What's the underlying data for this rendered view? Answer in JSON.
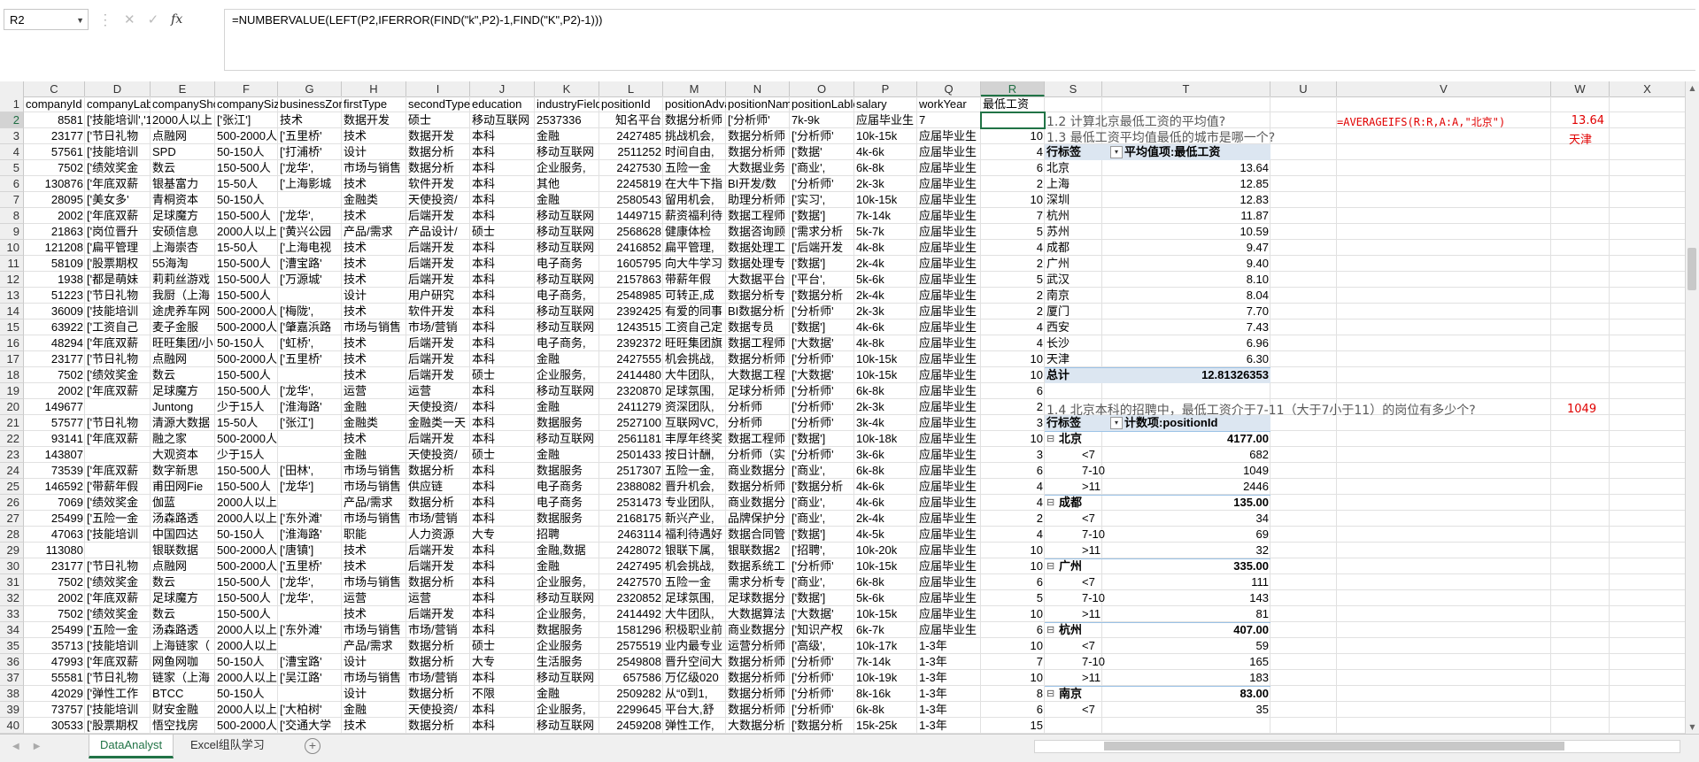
{
  "namebox": "R2",
  "formula": "=NUMBERVALUE(LEFT(P2,IFERROR(FIND(\"k\",P2)-1,FIND(\"K\",P2)-1)))",
  "columns": [
    "C",
    "D",
    "E",
    "F",
    "G",
    "H",
    "I",
    "J",
    "K",
    "L",
    "M",
    "N",
    "O",
    "P",
    "Q",
    "R",
    "S",
    "T",
    "U",
    "V",
    "W",
    "X"
  ],
  "row_numbers": [
    "1",
    "2",
    "3",
    "4",
    "5",
    "6",
    "7",
    "8",
    "9",
    "10",
    "11",
    "12",
    "13",
    "14",
    "15",
    "16",
    "17",
    "18",
    "19",
    "20",
    "21",
    "22",
    "23",
    "24",
    "25",
    "26",
    "27",
    "28",
    "29",
    "30",
    "31",
    "32",
    "33",
    "34",
    "35",
    "36",
    "37",
    "38",
    "39",
    "40"
  ],
  "headers": [
    "companyId",
    "companyLabelList",
    "companyShortName",
    "companySize",
    "businessZones",
    "firstType",
    "secondType",
    "education",
    "industryField",
    "positionId",
    "positionAdvantage",
    "positionName",
    "positionLables",
    "salary",
    "workYear",
    "最低工资"
  ],
  "rows": [
    [
      "8581",
      "['技能培训','1号店",
      "2000人以上",
      "['张江']",
      "技术",
      "数据开发",
      "硕士",
      "移动互联网",
      "2537336",
      "知名平台",
      "数据分析师",
      "['分析师'",
      "7k-9k",
      "应届毕业生",
      "7"
    ],
    [
      "23177",
      "['节日礼物",
      "点融网",
      "500-2000人",
      "['五里桥'",
      "技术",
      "数据开发",
      "本科",
      "金融",
      "2427485",
      "挑战机会,",
      "数据分析师",
      "['分析师'",
      "10k-15k",
      "应届毕业生",
      "10"
    ],
    [
      "57561",
      "['技能培训",
      "SPD",
      "50-150人",
      "['打浦桥'",
      "设计",
      "数据分析",
      "本科",
      "移动互联网",
      "2511252",
      "时间自由,",
      "数据分析师",
      "['数据'",
      "4k-6k",
      "应届毕业生",
      "4"
    ],
    [
      "7502",
      "['绩效奖金",
      "数云",
      "150-500人",
      "['龙华',",
      "市场与销售",
      "数据分析",
      "本科",
      "企业服务,",
      "2427530",
      "五险一金",
      "大数据业务",
      "['商业',",
      "6k-8k",
      "应届毕业生",
      "6"
    ],
    [
      "130876",
      "['年底双薪",
      "银基富力",
      "15-50人",
      "['上海影城",
      "技术",
      "软件开发",
      "本科",
      "其他",
      "2245819",
      "在大牛下指",
      "BI开发/数",
      "['分析师'",
      "2k-3k",
      "应届毕业生",
      "2"
    ],
    [
      "28095",
      "['美女多'",
      "青桐资本",
      "50-150人",
      "",
      "金融类",
      "天使投资/",
      "本科",
      "金融",
      "2580543",
      "留用机会,",
      "助理分析师",
      "['实习',",
      "10k-15k",
      "应届毕业生",
      "10"
    ],
    [
      "2002",
      "['年底双薪",
      "足球魔方",
      "150-500人",
      "['龙华',",
      "技术",
      "后端开发",
      "本科",
      "移动互联网",
      "1449715",
      "薪资福利待",
      "数据工程师",
      "['数据']",
      "7k-14k",
      "应届毕业生",
      "7"
    ],
    [
      "21863",
      "['岗位晋升",
      "安硕信息",
      "2000人以上",
      "['黄兴公园",
      "产品/需求",
      "产品设计/",
      "硕士",
      "移动互联网",
      "2568628",
      "健康体检",
      "数据咨询顾",
      "['需求分析",
      "5k-7k",
      "应届毕业生",
      "5"
    ],
    [
      "121208",
      "['扁平管理",
      "上海崇杏",
      "15-50人",
      "['上海电视",
      "技术",
      "后端开发",
      "本科",
      "移动互联网",
      "2416852",
      "扁平管理,",
      "数据处理工",
      "['后端开发",
      "4k-8k",
      "应届毕业生",
      "4"
    ],
    [
      "58109",
      "['股票期权",
      "55海淘",
      "150-500人",
      "['漕宝路'",
      "技术",
      "后端开发",
      "本科",
      "电子商务",
      "1605795",
      "向大牛学习",
      "数据处理专",
      "['数据']",
      "2k-4k",
      "应届毕业生",
      "2"
    ],
    [
      "1938",
      "['都是萌妹",
      "莉莉丝游戏",
      "150-500人",
      "['万源城'",
      "技术",
      "后端开发",
      "本科",
      "移动互联网",
      "2157863",
      "带薪年假",
      "大数据平台",
      "['平台',",
      "5k-6k",
      "应届毕业生",
      "5"
    ],
    [
      "51223",
      "['节日礼物",
      "我厨（上海",
      "150-500人",
      "",
      "设计",
      "用户研究",
      "本科",
      "电子商务,",
      "2548985",
      "可转正,成",
      "数据分析专",
      "['数据分析",
      "2k-4k",
      "应届毕业生",
      "2"
    ],
    [
      "36009",
      "['技能培训",
      "途虎养车网",
      "500-2000人",
      "['梅陇',",
      "技术",
      "软件开发",
      "本科",
      "移动互联网",
      "2392425",
      "有爱的同事",
      "BI数据分析",
      "['分析师'",
      "2k-3k",
      "应届毕业生",
      "2"
    ],
    [
      "63922",
      "['工资自己",
      "麦子金服",
      "500-2000人",
      "['肇嘉浜路",
      "市场与销售",
      "市场/营销",
      "本科",
      "移动互联网",
      "1243515",
      "工资自己定",
      "数据专员",
      "['数据']",
      "4k-6k",
      "应届毕业生",
      "4"
    ],
    [
      "48294",
      "['年底双薪",
      "旺旺集团/小",
      "50-150人",
      "['虹桥',",
      "技术",
      "后端开发",
      "本科",
      "电子商务,",
      "2392372",
      "旺旺集团旗",
      "数据工程师",
      "['大数据'",
      "4k-8k",
      "应届毕业生",
      "4"
    ],
    [
      "23177",
      "['节日礼物",
      "点融网",
      "500-2000人",
      "['五里桥'",
      "技术",
      "后端开发",
      "本科",
      "金融",
      "2427555",
      "机会挑战,",
      "数据分析师",
      "['分析师'",
      "10k-15k",
      "应届毕业生",
      "10"
    ],
    [
      "7502",
      "['绩效奖金",
      "数云",
      "150-500人",
      "",
      "技术",
      "后端开发",
      "硕士",
      "企业服务,",
      "2414480",
      "大牛团队,",
      "大数据工程",
      "['大数据'",
      "10k-15k",
      "应届毕业生",
      "10"
    ],
    [
      "2002",
      "['年底双薪",
      "足球魔方",
      "150-500人",
      "['龙华',",
      "运营",
      "运营",
      "本科",
      "移动互联网",
      "2320870",
      "足球氛围,",
      "足球分析师",
      "['分析师'",
      "6k-8k",
      "应届毕业生",
      "6"
    ],
    [
      "149677",
      "",
      "Juntong",
      "少于15人",
      "['淮海路'",
      "金融",
      "天使投资/",
      "本科",
      "金融",
      "2411279",
      "资深团队,",
      "分析师",
      "['分析师'",
      "2k-3k",
      "应届毕业生",
      "2"
    ],
    [
      "57577",
      "['节日礼物",
      "清源大数据",
      "15-50人",
      "['张江']",
      "金融类",
      "金融类一天",
      "本科",
      "数据服务",
      "2527100",
      "互联网VC,",
      "分析师",
      "['分析师'",
      "3k-4k",
      "应届毕业生",
      "3"
    ],
    [
      "93141",
      "['年底双薪",
      "融之家",
      "500-2000人",
      "",
      "技术",
      "后端开发",
      "本科",
      "移动互联网",
      "2561181",
      "丰厚年终奖",
      "数据工程师",
      "['数据']",
      "10k-18k",
      "应届毕业生",
      "10"
    ],
    [
      "143807",
      "",
      "大观资本",
      "少于15人",
      "",
      "金融",
      "天使投资/",
      "硕士",
      "金融",
      "2501433",
      "按日计酬,",
      "分析师（实",
      "['分析师'",
      "3k-6k",
      "应届毕业生",
      "3"
    ],
    [
      "73539",
      "['年底双薪",
      "数字新思",
      "150-500人",
      "['田林',",
      "市场与销售",
      "数据分析",
      "本科",
      "数据服务",
      "2517307",
      "五险一金,",
      "商业数据分",
      "['商业',",
      "6k-8k",
      "应届毕业生",
      "6"
    ],
    [
      "146592",
      "['带薪年假",
      "甫田网Fie",
      "150-500人",
      "['龙华']",
      "市场与销售",
      "供应链",
      "本科",
      "电子商务",
      "2388082",
      "晋升机会,",
      "数据分析师",
      "['数据分析",
      "4k-6k",
      "应届毕业生",
      "4"
    ],
    [
      "7069",
      "['绩效奖金",
      "伽蓝",
      "2000人以上",
      "",
      "产品/需求",
      "数据分析",
      "本科",
      "电子商务",
      "2531473",
      "专业团队,",
      "商业数据分",
      "['商业',",
      "4k-6k",
      "应届毕业生",
      "4"
    ],
    [
      "25499",
      "['五险一金",
      "汤森路透",
      "2000人以上",
      "['东外滩'",
      "市场与销售",
      "市场/营销",
      "本科",
      "数据服务",
      "2168175",
      "新兴产业,",
      "品牌保护分",
      "['商业',",
      "2k-4k",
      "应届毕业生",
      "2"
    ],
    [
      "47063",
      "['技能培训",
      "中国四达",
      "50-150人",
      "['淮海路'",
      "职能",
      "人力资源",
      "大专",
      "招聘",
      "2463114",
      "福利待遇好",
      "数据合同管",
      "['数据']",
      "4k-5k",
      "应届毕业生",
      "4"
    ],
    [
      "113080",
      "",
      "银联数据",
      "500-2000人",
      "['唐镇']",
      "技术",
      "后端开发",
      "本科",
      "金融,数据",
      "2428072",
      "银联下属,",
      "银联数据2",
      "['招聘',",
      "10k-20k",
      "应届毕业生",
      "10"
    ],
    [
      "23177",
      "['节日礼物",
      "点融网",
      "500-2000人",
      "['五里桥'",
      "技术",
      "后端开发",
      "本科",
      "金融",
      "2427495",
      "机会挑战,",
      "数据系统工",
      "['分析师'",
      "10k-15k",
      "应届毕业生",
      "10"
    ],
    [
      "7502",
      "['绩效奖金",
      "数云",
      "150-500人",
      "['龙华',",
      "市场与销售",
      "数据分析",
      "本科",
      "企业服务,",
      "2427570",
      "五险一金",
      "需求分析专",
      "['商业',",
      "6k-8k",
      "应届毕业生",
      "6"
    ],
    [
      "2002",
      "['年底双薪",
      "足球魔方",
      "150-500人",
      "['龙华',",
      "运营",
      "运营",
      "本科",
      "移动互联网",
      "2320852",
      "足球氛围,",
      "足球数据分",
      "['数据']",
      "5k-6k",
      "应届毕业生",
      "5"
    ],
    [
      "7502",
      "['绩效奖金",
      "数云",
      "150-500人",
      "",
      "技术",
      "后端开发",
      "本科",
      "企业服务,",
      "2414492",
      "大牛团队,",
      "大数据算法",
      "['大数据'",
      "10k-15k",
      "应届毕业生",
      "10"
    ],
    [
      "25499",
      "['五险一金",
      "汤森路透",
      "2000人以上",
      "['东外滩'",
      "市场与销售",
      "市场/营销",
      "本科",
      "数据服务",
      "1581296",
      "积极职业前",
      "商业数据分",
      "['知识产权",
      "6k-7k",
      "应届毕业生",
      "6"
    ],
    [
      "35713",
      "['技能培训",
      "上海链家（",
      "2000人以上",
      "",
      "产品/需求",
      "数据分析",
      "硕士",
      "企业服务",
      "2575519",
      "业内最专业",
      "运营分析师",
      "['高级',",
      "10k-17k",
      "1-3年",
      "10"
    ],
    [
      "47993",
      "['年底双薪",
      "网鱼网咖",
      "50-150人",
      "['漕宝路'",
      "设计",
      "数据分析",
      "大专",
      "生活服务",
      "2549808",
      "晋升空间大",
      "数据分析师",
      "['分析师'",
      "7k-14k",
      "1-3年",
      "7"
    ],
    [
      "55581",
      "['节日礼物",
      "链家（上海",
      "2000人以上",
      "['吴江路'",
      "市场与销售",
      "市场/营销",
      "本科",
      "移动互联网",
      "657586",
      "万亿级020",
      "数据分析师",
      "['分析师'",
      "10k-19k",
      "1-3年",
      "10"
    ],
    [
      "42029",
      "['弹性工作",
      "BTCC",
      "50-150人",
      "",
      "设计",
      "数据分析",
      "不限",
      "金融",
      "2509282",
      "从“0到1,",
      "数据分析师",
      "['分析师'",
      "8k-16k",
      "1-3年",
      "8"
    ],
    [
      "73757",
      "['技能培训",
      "财安金融",
      "2000人以上",
      "['大柏树'",
      "金融",
      "天使投资/",
      "本科",
      "企业服务,",
      "2299645",
      "平台大,舒",
      "数据分析师",
      "['分析师'",
      "6k-8k",
      "1-3年",
      "6"
    ],
    [
      "30533",
      "['股票期权",
      "悟空找房",
      "500-2000人",
      "['交通大学",
      "技术",
      "数据分析",
      "本科",
      "移动互联网",
      "2459208",
      "弹性工作,",
      "大数据分析",
      "['数据分析",
      "15k-25k",
      "1-3年",
      "15"
    ]
  ],
  "q12": "1.2 计算北京最低工资的平均值?",
  "q12_formula": "=AVERAGEIFS(R:R,A:A,\"北京\")",
  "q12_answer": "13.64",
  "q13": "1.3 最低工资平均值最低的城市是哪一个?",
  "q13_answer": "天津",
  "pivot1": {
    "hdr_label": "行标签",
    "hdr_value": "平均值项:最低工资",
    "rows": [
      {
        "city": "北京",
        "val": "13.64"
      },
      {
        "city": "上海",
        "val": "12.85"
      },
      {
        "city": "深圳",
        "val": "12.83"
      },
      {
        "city": "杭州",
        "val": "11.87"
      },
      {
        "city": "苏州",
        "val": "10.59"
      },
      {
        "city": "成都",
        "val": "9.47"
      },
      {
        "city": "广州",
        "val": "9.40"
      },
      {
        "city": "武汉",
        "val": "8.10"
      },
      {
        "city": "南京",
        "val": "8.04"
      },
      {
        "city": "厦门",
        "val": "7.70"
      },
      {
        "city": "西安",
        "val": "7.43"
      },
      {
        "city": "长沙",
        "val": "6.96"
      },
      {
        "city": "天津",
        "val": "6.30"
      }
    ],
    "total_label": "总计",
    "total_val": "12.81326353"
  },
  "q14": "1.4 北京本科的招聘中，最低工资介于7-11（大于7小于11）的岗位有多少个?",
  "q14_answer": "1049",
  "pivot2": {
    "hdr_label": "行标签",
    "hdr_value": "计数项:positionId",
    "groups": [
      {
        "city": "北京",
        "total": "4177.00",
        "items": [
          {
            "k": "<7",
            "v": "682"
          },
          {
            "k": "7-10",
            "v": "1049"
          },
          {
            "k": ">11",
            "v": "2446"
          }
        ]
      },
      {
        "city": "成都",
        "total": "135.00",
        "items": [
          {
            "k": "<7",
            "v": "34"
          },
          {
            "k": "7-10",
            "v": "69"
          },
          {
            "k": ">11",
            "v": "32"
          }
        ]
      },
      {
        "city": "广州",
        "total": "335.00",
        "items": [
          {
            "k": "<7",
            "v": "111"
          },
          {
            "k": "7-10",
            "v": "143"
          },
          {
            "k": ">11",
            "v": "81"
          }
        ]
      },
      {
        "city": "杭州",
        "total": "407.00",
        "items": [
          {
            "k": "<7",
            "v": "59"
          },
          {
            "k": "7-10",
            "v": "165"
          },
          {
            "k": ">11",
            "v": "183"
          }
        ]
      },
      {
        "city": "南京",
        "total": "83.00",
        "items": [
          {
            "k": "<7",
            "v": "35"
          }
        ]
      }
    ]
  },
  "sheets": [
    "DataAnalyst",
    "Excel组队学习"
  ],
  "colors": {
    "accent": "#217346",
    "red": "#e00000",
    "pivot_header": "#dce6f1"
  }
}
